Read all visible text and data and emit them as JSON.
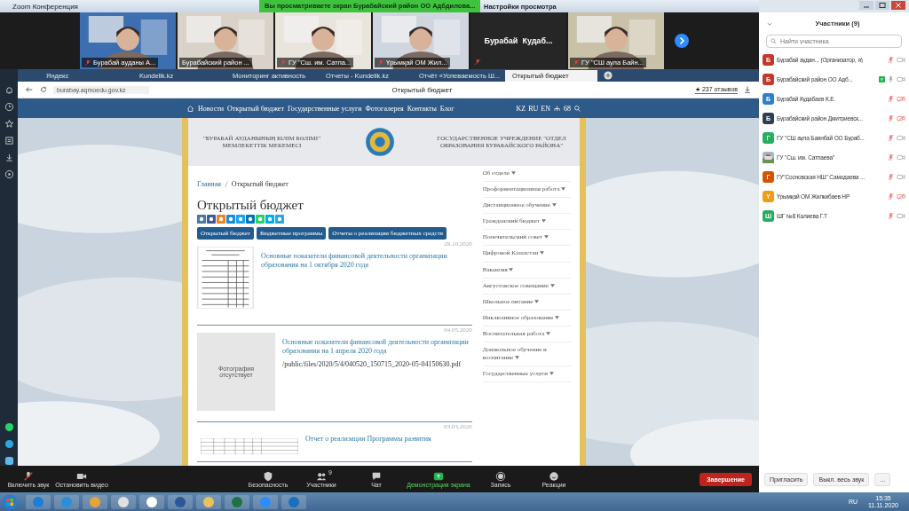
{
  "window": {
    "title": "Zoom Конференция"
  },
  "share_banner": {
    "text": "Вы просматриваете экран Бурабайский район ОО Адбдилова...",
    "view_options": "Настройки просмотра"
  },
  "video_tiles": [
    {
      "kind": "video",
      "name": "Бурабай ауданы А...",
      "muted": true
    },
    {
      "kind": "video",
      "name": "Бурабайский район ...",
      "muted": false
    },
    {
      "kind": "video",
      "name": "ГУ \"Сш. им. Сатпа...",
      "muted": true
    },
    {
      "kind": "video",
      "name": "Үрымқай ОМ Жил...",
      "muted": true
    },
    {
      "kind": "text",
      "name": "Бурабай  Кудаб...",
      "muted": true
    },
    {
      "kind": "video",
      "name": "ГУ \"СШ аула Байн...",
      "muted": true
    }
  ],
  "browser": {
    "tabs": [
      {
        "label": "Яндекс",
        "selected": false
      },
      {
        "label": "Kundelik.kz",
        "selected": false
      },
      {
        "label": "Мониторинг активность",
        "selected": false
      },
      {
        "label": "Отчеты - Kundelik.kz",
        "selected": false
      },
      {
        "label": "Отчёт «Успеваемость Ш...",
        "selected": false
      },
      {
        "label": "Открытый бюджет",
        "selected": true
      }
    ],
    "url": "burabay.aqmoedu.gov.kz",
    "page_title": "Открытый бюджет",
    "reviews": "★ 237 отзывов"
  },
  "site": {
    "nav": [
      "Новости",
      "Открытый бюджет",
      "Государственные услуги",
      "Фотогалерея",
      "Контакты",
      "Блог"
    ],
    "languages": [
      "KZ",
      "RU",
      "EN"
    ],
    "counter": "68",
    "header_left": "\"БУРАБАЙ АУДАНЫНЫҢ БІЛІМ БӨЛІМІ\" МЕМЛЕКЕТТІК МЕКЕМЕСІ",
    "header_right": "ГОСУДАРСТВЕННОЕ УЧРЕЖДЕНИЕ \"ОТДЕЛ ОБРАЗОВАНИЯ БУРАБАЙСКОГО РАЙОНА\"",
    "breadcrumbs": [
      {
        "label": "Главная",
        "link": true
      },
      {
        "label": "Открытый бюджет",
        "link": false
      }
    ],
    "heading": "Открытый бюджет",
    "filter_buttons": [
      "Открытый бюджет",
      "Бюджетные программы",
      "Отчеты о реализации бюджетных средств"
    ],
    "articles": [
      {
        "kind": "document",
        "date": "29.10.2020",
        "title": "Основные показатели финансовой деятельности организации образования на 1 октября 2020 года"
      },
      {
        "kind": "none",
        "thumb_text": "Фотография отсутствует",
        "date": "04.05.2020",
        "title": "Основные показатели финансовой деятельности организации образования на 1 апреля 2020 года",
        "file": "/public/files/2020/5/4/040520_150715_2020-05-04150630.pdf"
      },
      {
        "kind": "table",
        "date": "03.03.2020",
        "title": "Отчет о реализации Программы развития"
      }
    ],
    "menu": [
      "Об отделе",
      "Профориентационная работа",
      "Дистанционное обучение",
      "Гражданский бюджет",
      "Попечительский совет",
      "Цифровой Казахстан",
      "Вакансия",
      "Августовское совещание",
      "Школьное питание",
      "Инклюзивное образование",
      "Воспитательная работа",
      "Дошкольное обучение и воспитание",
      "Государственные услуги"
    ]
  },
  "toolbar": [
    {
      "kind": "audio",
      "label": "Включить звук"
    },
    {
      "kind": "video",
      "label": "Остановить видео"
    },
    {
      "kind": "security",
      "label": "Безопасность"
    },
    {
      "kind": "participants",
      "label": "Участники",
      "count": "9"
    },
    {
      "kind": "chat",
      "label": "Чат"
    },
    {
      "kind": "share",
      "label": "Демонстрация экрана"
    },
    {
      "kind": "record",
      "label": "Запись"
    },
    {
      "kind": "reactions",
      "label": "Реакции"
    }
  ],
  "end_button": "Завершение",
  "participants_panel": {
    "title": "Участники (9)",
    "search_placeholder": "Найти участника",
    "participants": [
      {
        "kind": "letter",
        "initial": "Б",
        "color": "#c0392b",
        "name": "Бурабай аудан... (Организатор, я)",
        "muted": true,
        "video_off": false,
        "sharing": false
      },
      {
        "kind": "letter",
        "initial": "Б",
        "color": "#c0392b",
        "name": "Бурабайский район ОО Адб...",
        "muted": false,
        "video_off": false,
        "sharing": true
      },
      {
        "kind": "letter",
        "initial": "Б",
        "color": "#2f80c8",
        "name": "Бурабай Кудабаев К.Е.",
        "muted": true,
        "video_off": true,
        "sharing": false
      },
      {
        "kind": "letter",
        "initial": "Б",
        "color": "#2c3e50",
        "name": "Бурабайский район Дмитриевск...",
        "muted": true,
        "video_off": true,
        "sharing": false
      },
      {
        "kind": "letter",
        "initial": "Г",
        "color": "#27ae60",
        "name": "ГУ \"СШ аула Баянбай ОО Бураб...",
        "muted": true,
        "video_off": false,
        "sharing": false
      },
      {
        "name": "ГУ \"Сш. им. Сатпаева\"",
        "muted": true,
        "video_off": false,
        "sharing": false
      },
      {
        "kind": "letter",
        "initial": "Г",
        "color": "#d35400",
        "name": "ГУ\"Сосновская НШ\" Самодаева ...",
        "muted": true,
        "video_off": false,
        "sharing": false
      },
      {
        "kind": "letter",
        "initial": "Ү",
        "color": "#f39c12",
        "name": "Үрымқай ОМ Жилкибаев НР",
        "muted": true,
        "video_off": true,
        "sharing": false
      },
      {
        "kind": "letter",
        "initial": "Ш",
        "color": "#27ae60",
        "name": "ШГ №8 Калиева Г.Т",
        "muted": true,
        "video_off": false,
        "sharing": false
      }
    ],
    "buttons": [
      "Пригласить",
      "Выкл. весь звук",
      "..."
    ]
  },
  "taskbar": {
    "language": "RU",
    "time": "15:35",
    "date": "11.11.2020"
  }
}
